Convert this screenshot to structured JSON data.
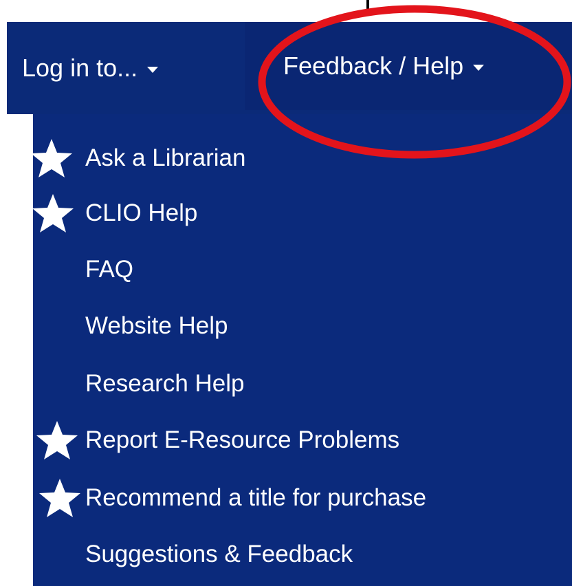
{
  "navbar": {
    "login": {
      "label": "Log in to...",
      "icon": "caret-down-icon"
    },
    "feedback": {
      "label": "Feedback / Help",
      "icon": "caret-down-icon"
    }
  },
  "dropdown": {
    "items": [
      {
        "label": "Ask a Librarian",
        "starred": true
      },
      {
        "label": "CLIO Help",
        "starred": true
      },
      {
        "label": "FAQ",
        "starred": false
      },
      {
        "label": "Website Help",
        "starred": false
      },
      {
        "label": "Research Help",
        "starred": false
      },
      {
        "label": "Report E-Resource Problems",
        "starred": true
      },
      {
        "label": "Recommend a title for purchase",
        "starred": true
      },
      {
        "label": "Suggestions & Feedback",
        "starred": false
      }
    ]
  },
  "annotation": {
    "highlight_color": "#e3141b",
    "shape": "ellipse",
    "marker": "star-icon"
  },
  "colors": {
    "navbar_bg": "#0b2a78",
    "dropdown_bg": "#0b2a7c",
    "text": "#ffffff"
  }
}
